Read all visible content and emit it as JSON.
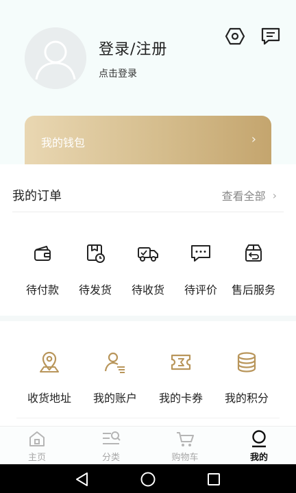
{
  "profile": {
    "title": "登录/注册",
    "subtitle": "点击登录",
    "avatar_icon": "user-avatar-placeholder",
    "settings_icon": "settings-hex-icon",
    "message_icon": "message-icon"
  },
  "wallet": {
    "label": "我的钱包",
    "arrow": "›"
  },
  "orders": {
    "title": "我的订单",
    "view_all": "查看全部",
    "view_all_chevron": "›",
    "items": [
      {
        "label": "待付款",
        "icon": "wallet-icon"
      },
      {
        "label": "待发货",
        "icon": "package-clock-icon"
      },
      {
        "label": "待收货",
        "icon": "truck-icon"
      },
      {
        "label": "待评价",
        "icon": "comment-icon"
      },
      {
        "label": "售后服务",
        "icon": "return-box-icon"
      }
    ]
  },
  "services": {
    "items": [
      {
        "label": "收货地址",
        "icon": "location-pin-icon"
      },
      {
        "label": "我的账户",
        "icon": "account-icon"
      },
      {
        "label": "我的卡券",
        "icon": "coupon-icon"
      },
      {
        "label": "我的积分",
        "icon": "coins-icon"
      }
    ]
  },
  "tabbar": {
    "items": [
      {
        "label": "主页",
        "icon": "home-icon",
        "active": false
      },
      {
        "label": "分类",
        "icon": "category-search-icon",
        "active": false
      },
      {
        "label": "购物车",
        "icon": "cart-icon",
        "active": false
      },
      {
        "label": "我的",
        "icon": "profile-icon",
        "active": true
      }
    ]
  },
  "colors": {
    "accent_gold": "#b8955a",
    "wallet_gradient_start": "#e9d7b2",
    "wallet_gradient_end": "#c4a56e",
    "tab_inactive": "#a7a7a7",
    "tab_active": "#111111"
  },
  "system_nav": {
    "back_icon": "back-triangle-icon",
    "home_icon": "home-circle-icon",
    "recents_icon": "recents-square-icon"
  }
}
